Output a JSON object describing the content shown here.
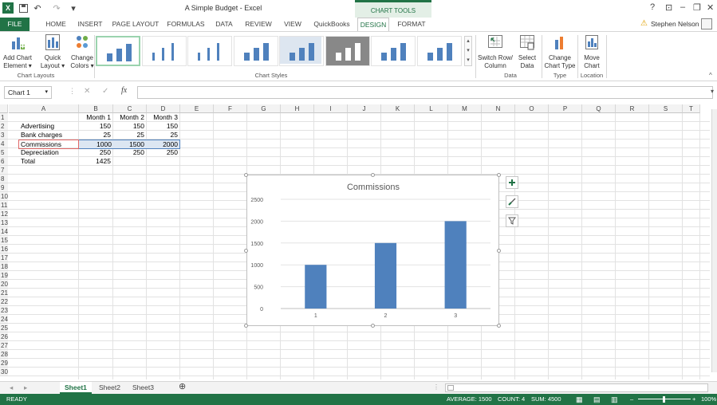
{
  "titlebar": {
    "title": "A Simple Budget - Excel",
    "chart_tools": "CHART TOOLS",
    "help": "?",
    "user": "Stephen Nelson"
  },
  "tabs": [
    "FILE",
    "HOME",
    "INSERT",
    "PAGE LAYOUT",
    "FORMULAS",
    "DATA",
    "REVIEW",
    "VIEW",
    "QuickBooks",
    "DESIGN",
    "FORMAT"
  ],
  "ribbon": {
    "add_chart_element": [
      "Add Chart",
      "Element ▾"
    ],
    "quick_layout": [
      "Quick",
      "Layout ▾"
    ],
    "change_colors": [
      "Change",
      "Colors ▾"
    ],
    "switch_row_col": [
      "Switch Row/",
      "Column"
    ],
    "select_data": [
      "Select",
      "Data"
    ],
    "change_chart_type": [
      "Change",
      "Chart Type"
    ],
    "move_chart": [
      "Move",
      "Chart"
    ],
    "groups": {
      "chart_layouts": "Chart Layouts",
      "chart_styles": "Chart Styles",
      "data": "Data",
      "type": "Type",
      "location": "Location"
    }
  },
  "formula_bar": {
    "name_box": "Chart 1",
    "fx": "fx",
    "value": ""
  },
  "columns": [
    "A",
    "B",
    "C",
    "D",
    "E",
    "F",
    "G",
    "H",
    "I",
    "J",
    "K",
    "L",
    "M",
    "N",
    "O",
    "P",
    "Q",
    "R",
    "S",
    "T"
  ],
  "rows": [
    "1",
    "2",
    "3",
    "4",
    "5",
    "6",
    "7",
    "8",
    "9",
    "10",
    "11",
    "12",
    "13",
    "14",
    "15",
    "16",
    "17",
    "18",
    "19",
    "20",
    "21",
    "22",
    "23",
    "24",
    "25",
    "26",
    "27",
    "28",
    "29",
    "30"
  ],
  "cells": {
    "headers": [
      "Month 1",
      "Month 2",
      "Month 3"
    ],
    "items": [
      {
        "label": "Advertising",
        "values": [
          "150",
          "150",
          "150"
        ]
      },
      {
        "label": "Bank charges",
        "values": [
          "25",
          "25",
          "25"
        ]
      },
      {
        "label": "Commissions",
        "values": [
          "1000",
          "1500",
          "2000"
        ]
      },
      {
        "label": "Depreciation",
        "values": [
          "250",
          "250",
          "250"
        ]
      },
      {
        "label": "Total",
        "values": [
          "1425",
          "",
          ""
        ]
      }
    ]
  },
  "chart_data": {
    "type": "bar",
    "title": "Commissions",
    "categories": [
      "1",
      "2",
      "3"
    ],
    "values": [
      1000,
      1500,
      2000
    ],
    "ylim": [
      0,
      2500
    ],
    "yticks": [
      "0",
      "500",
      "1000",
      "1500",
      "2000",
      "2500"
    ],
    "xlabel": "",
    "ylabel": "",
    "grid": true,
    "color": "#4f81bd"
  },
  "sheets": [
    "Sheet1",
    "Sheet2",
    "Sheet3"
  ],
  "status": {
    "ready": "READY",
    "average": "AVERAGE: 1500",
    "count": "COUNT: 4",
    "sum": "SUM: 4500",
    "zoom": "100%"
  },
  "colors": {
    "accent": "#217346"
  }
}
